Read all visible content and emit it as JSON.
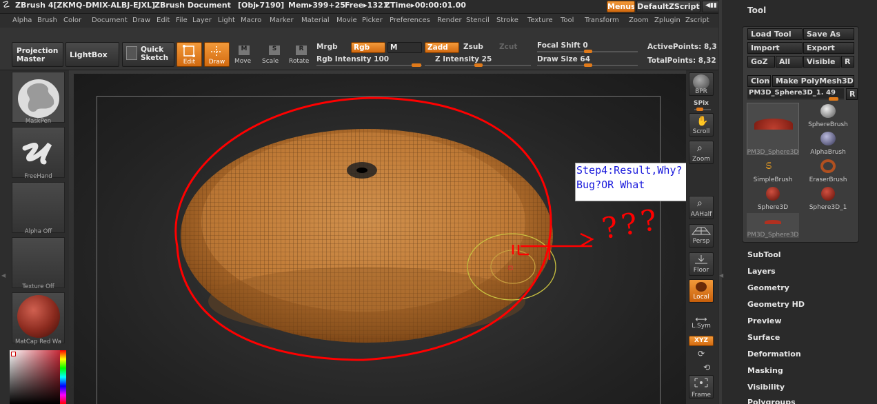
{
  "title": {
    "app": "ZBrush 4[ZKMQ-DMIX-ALBJ-EJXL]",
    "doc": "ZBrush Document",
    "obj": "[Obj▸7190]",
    "mem": "Mem▸399+25",
    "free": "Free▸1321",
    "ztime": "ZTime▸00:00:01.00",
    "menus_btn": "Menus",
    "script_btn": "DefaultZScript"
  },
  "menu": [
    "Alpha",
    "Brush",
    "Color",
    "Document",
    "Draw",
    "Edit",
    "File",
    "Layer",
    "Light",
    "Macro",
    "Marker",
    "Material",
    "Movie",
    "Picker",
    "Preferences",
    "Render",
    "Stencil",
    "Stroke",
    "Texture",
    "Tool",
    "Transform",
    "Zoom",
    "Zplugin",
    "Zscript"
  ],
  "shelf": {
    "projection": "Projection",
    "master": "Master",
    "lightbox": "LightBox",
    "quick": "Quick",
    "sketch": "Sketch",
    "edit": "Edit",
    "draw": "Draw",
    "move": "Move",
    "scale": "Scale",
    "rotate": "Rotate",
    "mrgb": "Mrgb",
    "rgb": "Rgb",
    "m": "M",
    "zadd": "Zadd",
    "zsub": "Zsub",
    "zcut": "Zcut",
    "rgb_int": "Rgb Intensity 100",
    "z_int": "Z Intensity 25",
    "focal": "Focal Shift 0",
    "drawsize": "Draw Size 64",
    "active": "ActivePoints: 8,3",
    "total": "TotalPoints: 8,32",
    "rgb_intensity_value": 100,
    "z_intensity_value": 25,
    "focal_shift_value": 0,
    "draw_size_value": 64
  },
  "left": [
    "MaskPen",
    "FreeHand",
    "Alpha Off",
    "Texture Off",
    "MatCap Red Wa"
  ],
  "right": [
    "BPR",
    "SPix",
    "Scroll",
    "Zoom",
    "AAHalf",
    "Persp",
    "Floor",
    "Local",
    "L.Sym",
    "XYZ",
    "Frame"
  ],
  "tool": {
    "header": "Tool",
    "load": "Load Tool",
    "save": "Save As",
    "import": "Import",
    "export": "Export",
    "goz": "GoZ",
    "all": "All",
    "visible": "Visible",
    "r": "R",
    "clone": "Clone",
    "make": "Make PolyMesh3D",
    "slider": "PM3D_Sphere3D_1. 49",
    "tiles": [
      "PM3D_Sphere3D",
      "SphereBrush",
      "AlphaBrush",
      "SimpleBrush",
      "EraserBrush",
      "Sphere3D",
      "Sphere3D_1",
      "PM3D_Sphere3D"
    ]
  },
  "sections": [
    "SubTool",
    "Layers",
    "Geometry",
    "Geometry HD",
    "Preview",
    "Surface",
    "Deformation",
    "Masking",
    "Visibility",
    "Polygroups"
  ],
  "note": {
    "line1": "Step4:Result,Why?",
    "line2": "Bug?OR What"
  },
  "scribble": "???"
}
